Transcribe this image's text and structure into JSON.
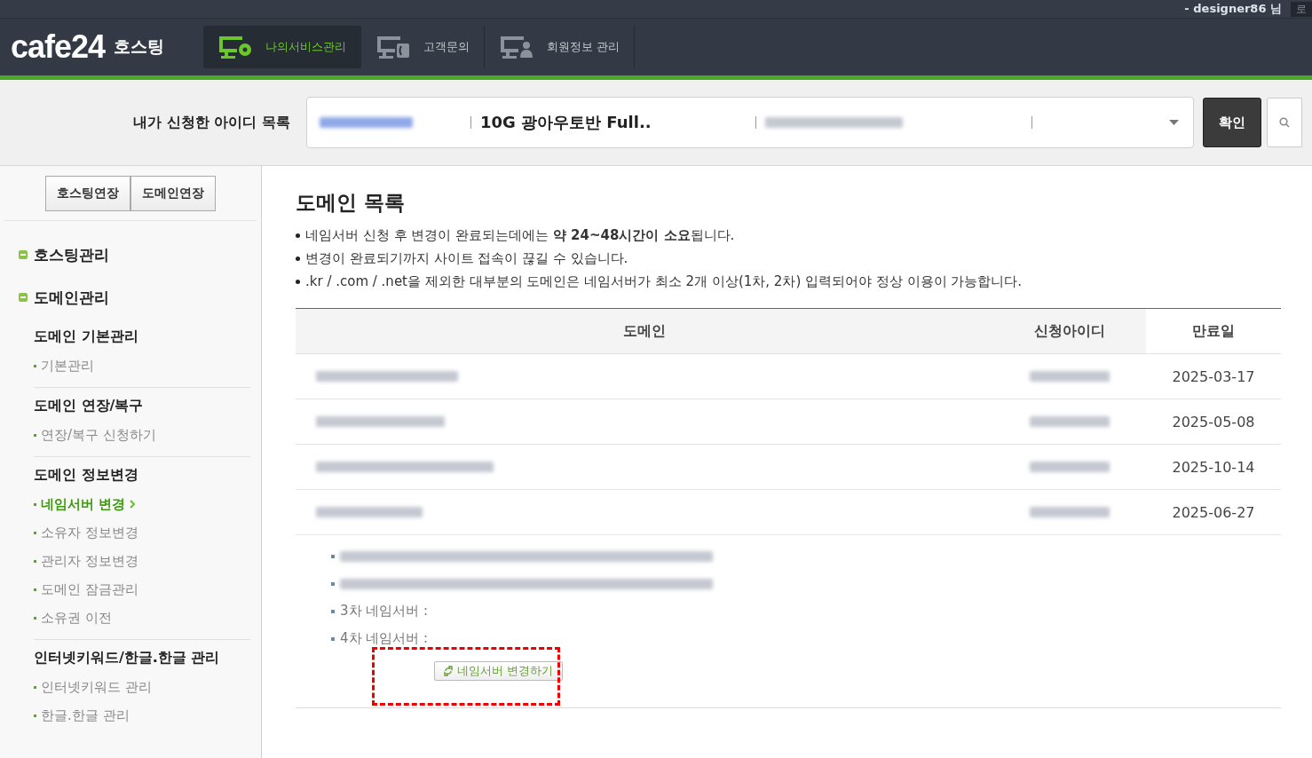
{
  "top_bar": {
    "user": "- designer86 님",
    "logout": "로"
  },
  "header": {
    "logo": "cafe24",
    "logo_sub": "호스팅",
    "tabs": [
      {
        "label": "나의서비스관리",
        "selected": true
      },
      {
        "label": "고객문의",
        "selected": false
      },
      {
        "label": "회원정보 관리",
        "selected": false
      }
    ]
  },
  "account_bar": {
    "label": "내가 신청한 아이디 목록",
    "service": "10G 광아우토반 Full..",
    "confirm": "확인"
  },
  "sidebar": {
    "buttons": [
      "호스팅연장",
      "도메인연장"
    ],
    "groups": [
      {
        "label": "호스팅관리",
        "expanded": true
      },
      {
        "label": "도메인관리",
        "expanded": true
      }
    ],
    "sections": [
      {
        "title": "도메인 기본관리",
        "items": [
          {
            "label": "기본관리",
            "selected": false
          }
        ]
      },
      {
        "title": "도메인 연장/복구",
        "items": [
          {
            "label": "연장/복구 신청하기",
            "selected": false
          }
        ]
      },
      {
        "title": "도메인 정보변경",
        "items": [
          {
            "label": "네임서버 변경",
            "selected": true
          },
          {
            "label": "소유자 정보변경",
            "selected": false
          },
          {
            "label": "관리자 정보변경",
            "selected": false
          },
          {
            "label": "도메인 잠금관리",
            "selected": false
          },
          {
            "label": "소유권 이전",
            "selected": false
          }
        ]
      },
      {
        "title": "인터넷키워드/한글.한글 관리",
        "items": [
          {
            "label": "인터넷키워드 관리",
            "selected": false
          },
          {
            "label": "한글.한글 관리",
            "selected": false
          }
        ]
      }
    ]
  },
  "content": {
    "title": "도메인 목록",
    "notes": [
      "네임서버 신청 후 변경이 완료되는데에는 **약 24~48시간이 소요**됩니다.",
      "변경이 완료되기까지 사이트 접속이 끊길 수 있습니다.",
      ".kr / .com / .net을 제외한 대부분의 도메인은 네임서버가 최소 2개 이상(1차, 2차) 입력되어야 정상 이용이 가능합니다."
    ],
    "table": {
      "columns": [
        "도메인",
        "신청아이디",
        "만료일"
      ],
      "rows": [
        {
          "expiry": "2025-03-17"
        },
        {
          "expiry": "2025-05-08"
        },
        {
          "expiry": "2025-10-14"
        },
        {
          "expiry": "2025-06-27"
        }
      ]
    },
    "nameservers": [
      {
        "kind": "blurred"
      },
      {
        "kind": "blurred"
      },
      {
        "kind": "text",
        "label": "3차 네임서버 :"
      },
      {
        "kind": "text",
        "label": "4차 네임서버 :"
      }
    ],
    "change_button": "네임서버 변경하기"
  }
}
